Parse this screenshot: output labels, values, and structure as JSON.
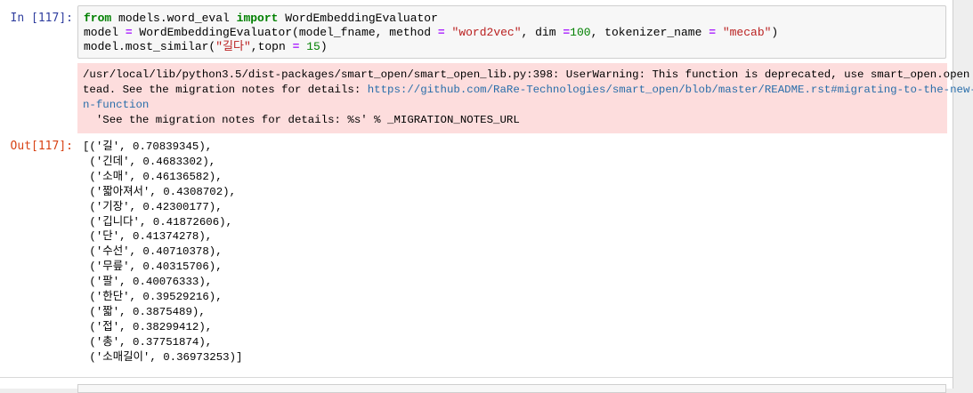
{
  "cell": {
    "in_prompt": "In [117]:",
    "out_prompt": "Out[117]:",
    "code": {
      "line1": {
        "kw_from": "from",
        "module": " models.word_eval ",
        "kw_import": "import",
        "name": " WordEmbeddingEvaluator"
      },
      "line2": {
        "p1": "model ",
        "eq1": "=",
        "p2": " WordEmbeddingEvaluator(model_fname, method ",
        "eq2": "=",
        "p3": " ",
        "s1": "\"word2vec\"",
        "p4": ", dim ",
        "eq3": "=",
        "n1": "100",
        "p5": ", tokenizer_name ",
        "eq4": "=",
        "p6": " ",
        "s2": "\"mecab\"",
        "p7": ")"
      },
      "line3": {
        "p1": "model.most_similar(",
        "s1": "\"길다\"",
        "p2": ",topn ",
        "eq1": "=",
        "p3": " ",
        "n1": "15",
        "p4": ")"
      }
    },
    "stderr": {
      "line1": "/usr/local/lib/python3.5/dist-packages/smart_open/smart_open_lib.py:398: UserWarning: This function is deprecated, use smart_open.open ins",
      "line2_prefix": "tead. See the migration notes for details: ",
      "link_part1": "https://github.com/RaRe-Technologies/smart_open/blob/master/README.rst#migrating-to-the-new-ope",
      "link_part2": "n-function",
      "line4": "  'See the migration notes for details: %s' % _MIGRATION_NOTES_URL"
    },
    "output_lines": [
      "[('길', 0.70839345),",
      " ('긴데', 0.4683302),",
      " ('소매', 0.46136582),",
      " ('짧아져서', 0.4308702),",
      " ('기장', 0.42300177),",
      " ('깁니다', 0.41872606),",
      " ('단', 0.41374278),",
      " ('수선', 0.40710378),",
      " ('무릎', 0.40315706),",
      " ('팔', 0.40076333),",
      " ('한단', 0.39529216),",
      " ('짧', 0.3875489),",
      " ('접', 0.38299412),",
      " ('총', 0.37751874),",
      " ('소매길이', 0.36973253)]"
    ]
  },
  "colors": {
    "in_prompt": "#303f9f",
    "out_prompt": "#d84315",
    "keyword": "#008000",
    "string": "#ba2121",
    "operator": "#aa22ff",
    "stderr_background": "#fddddd",
    "link": "#296eaa"
  }
}
